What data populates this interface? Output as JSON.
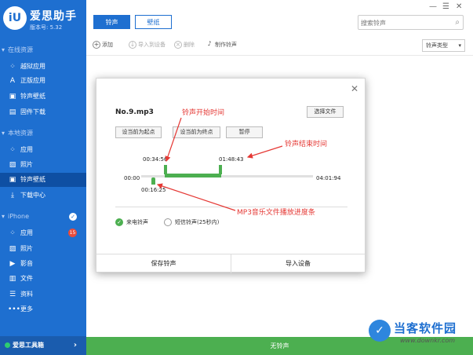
{
  "app": {
    "name": "爱思助手",
    "version": "版本号: 5.32",
    "logo": "iU"
  },
  "sidebar": {
    "online_section": "在线资源",
    "online_items": [
      {
        "label": "越狱应用",
        "icon": "apps-grid-icon"
      },
      {
        "label": "正版应用",
        "icon": "app-store-icon"
      },
      {
        "label": "铃声壁纸",
        "icon": "ringtone-icon"
      },
      {
        "label": "固件下载",
        "icon": "firmware-box-icon"
      }
    ],
    "local_section": "本地资源",
    "local_items": [
      {
        "label": "应用",
        "icon": "apps-grid-icon"
      },
      {
        "label": "照片",
        "icon": "photo-icon"
      },
      {
        "label": "铃声壁纸",
        "icon": "ringtone-icon",
        "active": true
      },
      {
        "label": "下载中心",
        "icon": "download-icon"
      }
    ],
    "device_section": "iPhone",
    "device_items": [
      {
        "label": "应用",
        "icon": "apps-grid-icon",
        "badge": "15"
      },
      {
        "label": "照片",
        "icon": "photo-icon"
      },
      {
        "label": "影音",
        "icon": "video-icon"
      },
      {
        "label": "文件",
        "icon": "file-icon"
      },
      {
        "label": "资料",
        "icon": "list-icon"
      },
      {
        "label": "更多",
        "icon": "more-icon"
      }
    ],
    "toolbox": "爱思工具箱"
  },
  "header": {
    "tabs": [
      "铃声",
      "壁纸"
    ],
    "search_placeholder": "搜索铃声",
    "actions": [
      {
        "label": "添加",
        "icon": "plus-icon",
        "enabled": true
      },
      {
        "label": "导入到设备",
        "icon": "import-icon",
        "enabled": false
      },
      {
        "label": "删除",
        "icon": "delete-icon",
        "enabled": false
      },
      {
        "label": "制作铃声",
        "icon": "bell-icon",
        "enabled": true
      }
    ],
    "type_select": "铃声类型"
  },
  "status_bar": "无铃声",
  "dialog": {
    "file_name": "No.9.mp3",
    "choose_file": "选择文件",
    "set_start": "设当前为起点",
    "set_end": "设当前为终点",
    "pause": "暂停",
    "start_time": "00:34:56",
    "end_time": "01:48:43",
    "current_time": "00:16:25",
    "track_start": "00:00",
    "track_end": "04:01:94",
    "progress": {
      "selection_start_fraction": 0.137,
      "selection_end_fraction": 0.454,
      "playhead_fraction": 0.066
    },
    "radio_call": "来电铃声",
    "radio_sms": "短信铃声(25秒内)",
    "save": "保存铃声",
    "import": "导入设备"
  },
  "annotations": {
    "start": "铃声开始时间",
    "end": "铃声结束时间",
    "progress": "MP3音乐文件播放进度条"
  },
  "watermark": {
    "title": "当客软件园",
    "url": "www.downkr.com"
  },
  "colors": {
    "sidebar": "#1e6fd0",
    "accent_green": "#4caf50",
    "annotation_red": "#e53935"
  }
}
